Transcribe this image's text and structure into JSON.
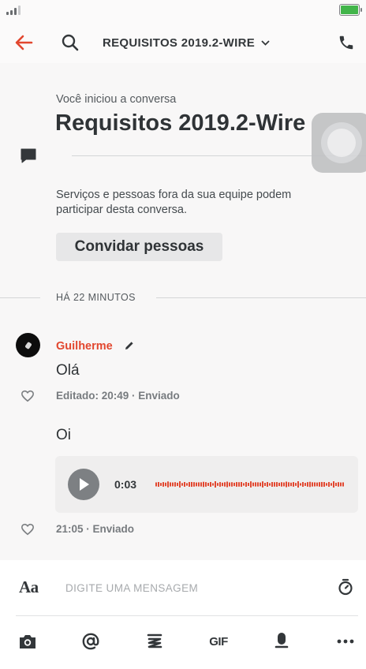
{
  "header": {
    "title": "REQUISITOS 2019.2-WIRE",
    "back_icon": "arrow-left-icon",
    "search_icon": "search-icon",
    "call_icon": "phone-icon",
    "accent_color": "#e2472f"
  },
  "conversation": {
    "started_label": "Você iniciou a conversa",
    "title": "Requisitos 2019.2-Wire",
    "guests_notice": "Serviços e pessoas fora da sua equipe podem participar desta conversa.",
    "invite_button": "Convidar pessoas"
  },
  "timeline": {
    "separator": "HÁ 22 MINUTOS"
  },
  "messages": [
    {
      "sender": "Guilherme",
      "text": "Olá",
      "meta": "Editado: 20:49 · Enviado"
    },
    {
      "text": "Oi",
      "audio_duration": "0:03",
      "meta": "21:05 · Enviado"
    }
  ],
  "composer": {
    "format_button": "Aa",
    "placeholder": "DIGITE UMA MENSAGEM",
    "toolbar": {
      "gif_label": "GIF"
    }
  }
}
